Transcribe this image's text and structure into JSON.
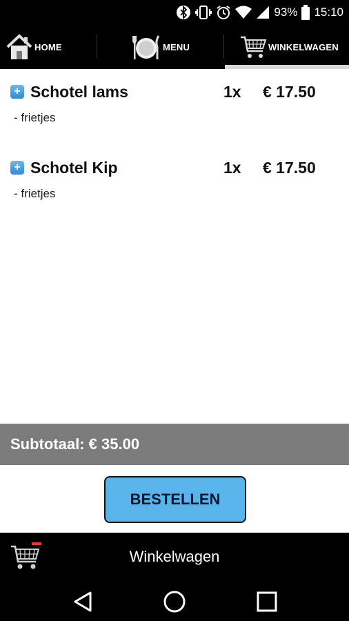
{
  "status_bar": {
    "battery": "93%",
    "time": "15:10",
    "icons": [
      "bluetooth-icon",
      "vibrate-icon",
      "alarm-icon",
      "wifi-icon",
      "signal-icon",
      "battery-icon"
    ]
  },
  "tabs": [
    {
      "label": "HOME",
      "icon": "home-icon"
    },
    {
      "label": "MENU",
      "icon": "menu-plate-icon"
    },
    {
      "label": "WINKELWAGEN",
      "icon": "cart-icon"
    }
  ],
  "cart": {
    "items": [
      {
        "name": "Schotel lams",
        "qty": "1x",
        "price": "€ 17.50",
        "detail": "- frietjes"
      },
      {
        "name": "Schotel Kip",
        "qty": "1x",
        "price": "€ 17.50",
        "detail": "- frietjes"
      }
    ],
    "subtotal_label": "Subtotaal: € 35.00"
  },
  "order_button_label": "BESTELLEN",
  "bottom_bar": {
    "title": "Winkelwagen",
    "icon": "cart-icon"
  },
  "colors": {
    "accent": "#5ab4ec",
    "subtotal_bg": "#7b7b7b",
    "bar_bg": "#000000"
  },
  "nav_bar": {
    "buttons": [
      "back-icon",
      "home-circle-icon",
      "recents-icon"
    ]
  }
}
